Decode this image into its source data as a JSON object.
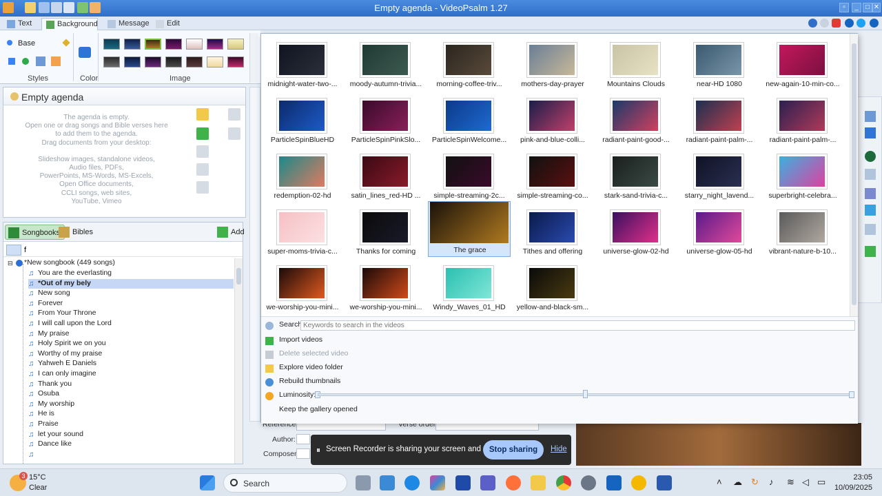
{
  "window": {
    "title": "Empty agenda - VideoPsalm 1.27"
  },
  "ribbon": {
    "tabs": [
      {
        "label": "Text"
      },
      {
        "label": "Background"
      },
      {
        "label": "Message"
      },
      {
        "label": "Edit"
      }
    ],
    "styles_value": "Base",
    "group_styles": "Styles",
    "group_color": "Color",
    "group_image": "Image"
  },
  "agenda": {
    "title": "Empty agenda",
    "empty_lines": [
      "The agenda is empty.",
      "Open one or drag songs and Bible verses here",
      "to add them to the agenda.",
      "Drag documents from your desktop:",
      "",
      "Slideshow images, standalone videos,",
      "Audio files, PDFs,",
      "PowerPoints, MS-Words, MS-Excels,",
      "Open Office documents,",
      "CCLI songs, web sites,",
      "YouTube, Vimeo"
    ]
  },
  "songbooks": {
    "tab_songbooks": "Songbooks",
    "tab_bibles": "Bibles",
    "add_label": "Add",
    "search_value": "f",
    "root": "*New songbook (449 songs)",
    "songs": [
      "You are the everlasting",
      "*Out of my bely",
      "New song",
      "Forever",
      "From Your Throne",
      "I will call upon the Lord",
      "My praise",
      "Holy Spirit we on you",
      "Worthy of my praise",
      "Yahweh E Daniels",
      "I can only imagine",
      "Thank you",
      "Osuba",
      "My worship",
      "He is",
      "Praise",
      "let your sound",
      "Dance like",
      ""
    ],
    "selected_index": 1
  },
  "behind": {
    "references_label": "References:",
    "verse_order_label": "Verse order:",
    "author_label": "Author:",
    "composer_label": "Composer:"
  },
  "gallery": {
    "videos": [
      {
        "name": "midnight-water-two-...",
        "colors": [
          "#0f1420",
          "#2a2f3a"
        ]
      },
      {
        "name": "moody-autumn-trivia...",
        "colors": [
          "#1f3a34",
          "#3d5a50"
        ]
      },
      {
        "name": "morning-coffee-triv...",
        "colors": [
          "#2b2620",
          "#5a4a3a"
        ]
      },
      {
        "name": "mothers-day-prayer",
        "colors": [
          "#6a7f96",
          "#c7b899"
        ]
      },
      {
        "name": "Mountains Clouds",
        "colors": [
          "#c9c4a4",
          "#e8e2c6"
        ]
      },
      {
        "name": "near-HD 1080",
        "colors": [
          "#3a5a70",
          "#7a95a8"
        ]
      },
      {
        "name": "new-again-10-min-co...",
        "colors": [
          "#c2185b",
          "#7b1040"
        ]
      },
      {
        "name": "ParticleSpinBlueHD",
        "colors": [
          "#0b2a6b",
          "#1e5ac8"
        ]
      },
      {
        "name": "ParticleSpinPinkSlo...",
        "colors": [
          "#3a0a2a",
          "#8a1f5a"
        ]
      },
      {
        "name": "ParticleSpinWelcome...",
        "colors": [
          "#0b3a8a",
          "#1f6ad0"
        ]
      },
      {
        "name": "pink-and-blue-colli...",
        "colors": [
          "#1a1e4a",
          "#c0406a"
        ]
      },
      {
        "name": "radiant-paint-good-...",
        "colors": [
          "#1a3a6a",
          "#d04060"
        ]
      },
      {
        "name": "radiant-paint-palm-...",
        "colors": [
          "#1a3050",
          "#c04050"
        ]
      },
      {
        "name": "radiant-paint-palm-...",
        "colors": [
          "#2a2050",
          "#b03a5a"
        ]
      },
      {
        "name": "redemption-02-hd",
        "colors": [
          "#1a8a8a",
          "#e07a60"
        ]
      },
      {
        "name": "satin_lines_red-HD ...",
        "colors": [
          "#3a0a14",
          "#8a1a2a"
        ]
      },
      {
        "name": "simple-streaming-2c...",
        "colors": [
          "#111111",
          "#3a0a2a"
        ]
      },
      {
        "name": "simple-streaming-co...",
        "colors": [
          "#111111",
          "#5a1010"
        ]
      },
      {
        "name": "stark-sand-trivia-c...",
        "colors": [
          "#1a1f1d",
          "#3a4a44"
        ]
      },
      {
        "name": "starry_night_lavend...",
        "colors": [
          "#101225",
          "#2a2f50"
        ]
      },
      {
        "name": "superbright-celebra...",
        "colors": [
          "#3ab0e0",
          "#e040a0"
        ]
      },
      {
        "name": "super-moms-trivia-c...",
        "colors": [
          "#f6c0c4",
          "#fbe0e2"
        ]
      },
      {
        "name": "Thanks for coming",
        "colors": [
          "#0a0a0a",
          "#1a1a2a"
        ]
      },
      {
        "name": "The grace",
        "colors": [
          "#1a120a",
          "#b07a20"
        ]
      },
      {
        "name": "Tithes and offering",
        "colors": [
          "#0a1a4a",
          "#2a4ab0"
        ]
      },
      {
        "name": "universe-glow-02-hd",
        "colors": [
          "#3a1060",
          "#e0308a"
        ]
      },
      {
        "name": "universe-glow-05-hd",
        "colors": [
          "#5a1a8a",
          "#e04a9a"
        ]
      },
      {
        "name": "vibrant-nature-b-10...",
        "colors": [
          "#5a5a5a",
          "#b0a8a0"
        ]
      },
      {
        "name": "we-worship-you-mini...",
        "colors": [
          "#1a0a0a",
          "#e05a20"
        ]
      },
      {
        "name": "we-worship-you-mini...",
        "colors": [
          "#1a0a0a",
          "#d04a1a"
        ]
      },
      {
        "name": "Windy_Waves_01_HD",
        "colors": [
          "#2ac0b0",
          "#80e6d8"
        ]
      },
      {
        "name": "yellow-and-black-sm...",
        "colors": [
          "#0a0a0a",
          "#4a3a10"
        ]
      }
    ],
    "selected_index": 23,
    "search_label": "Search",
    "search_placeholder": "Keywords to search in the videos",
    "import_label": "Import videos",
    "delete_label": "Delete selected video",
    "explore_label": "Explore video folder",
    "rebuild_label": "Rebuild thumbnails",
    "luminosity_label": "Luminosity:",
    "luminosity_level": 0.5,
    "keep_open_label": "Keep the gallery opened"
  },
  "sharebar": {
    "message": "Screen Recorder is sharing your screen and audio.",
    "stop_label": "Stop sharing",
    "hide_label": "Hide"
  },
  "taskbar": {
    "weather_badge": "3",
    "weather_temp": "15°C",
    "weather_desc": "Clear",
    "search_label": "Search",
    "time": "23:05",
    "date": "10/09/2025"
  }
}
